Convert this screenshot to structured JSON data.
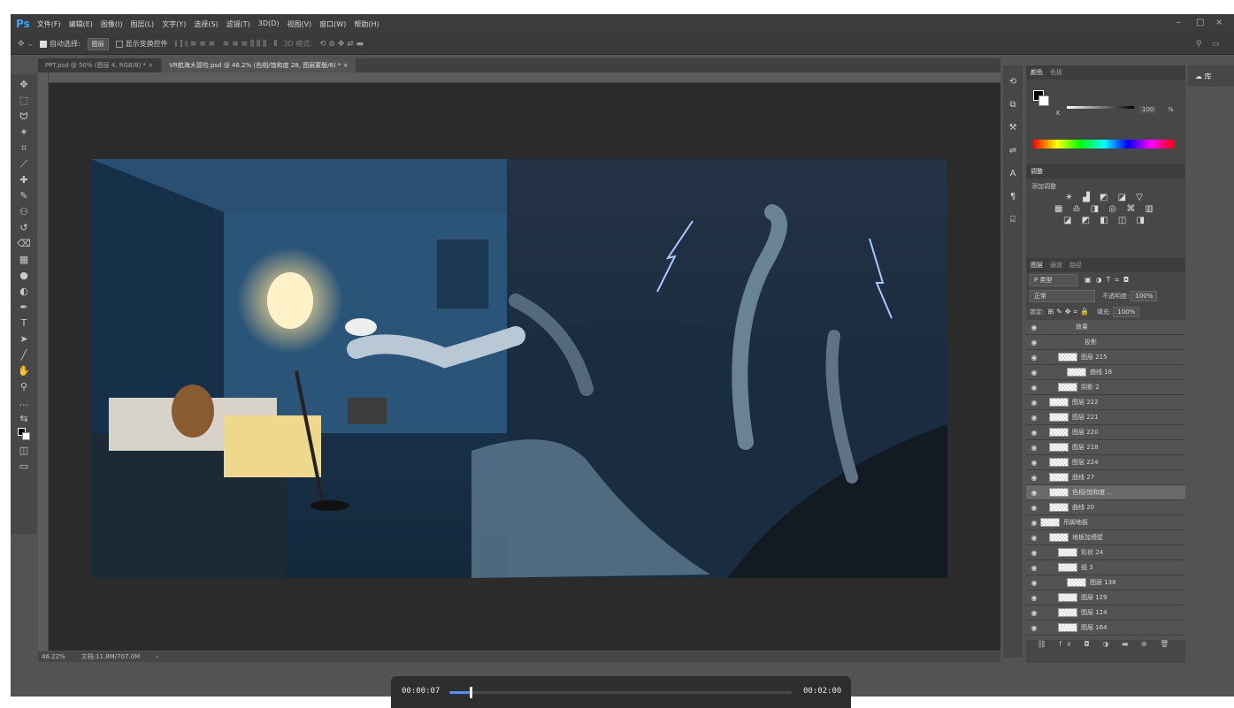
{
  "app": {
    "logo": "Ps",
    "menu": [
      "文件(F)",
      "编辑(E)",
      "图像(I)",
      "图层(L)",
      "文字(Y)",
      "选择(S)",
      "滤镜(T)",
      "3D(D)",
      "视图(V)",
      "窗口(W)",
      "帮助(H)"
    ],
    "window_controls": {
      "minimize": "–",
      "maximize": "□",
      "close": "×"
    }
  },
  "options_bar": {
    "auto_select_label": "自动选择:",
    "auto_select_value": "图层",
    "show_transform_label": "显示变换控件",
    "mode_label": "3D 模式:"
  },
  "tabs": [
    {
      "label": "PPT.psd @ 50% (图层 4, RGB/8) *  ×",
      "active": false
    },
    {
      "label": "VR航海大冒险.psd @ 46.2% (色相/饱和度 28, 图层蒙版/8) *  ×",
      "active": true
    }
  ],
  "tools": [
    "move-icon",
    "marquee-icon",
    "lasso-icon",
    "magic-wand-icon",
    "crop-icon",
    "eyedropper-icon",
    "healing-icon",
    "brush-icon",
    "stamp-icon",
    "history-brush-icon",
    "eraser-icon",
    "gradient-icon",
    "blur-icon",
    "dodge-icon",
    "pen-icon",
    "type-icon",
    "path-select-icon",
    "line-icon",
    "hand-icon",
    "zoom-icon",
    "more-icon",
    "swap-colors-icon",
    "color-swatches-icon",
    "quick-mask-icon",
    "screen-mode-icon"
  ],
  "tool_glyphs": [
    "✥",
    "⬚",
    "ᗢ",
    "✶",
    "⌗",
    "⟋",
    "✚",
    "✎",
    "⚇",
    "↺",
    "⌫",
    "▦",
    "●",
    "◐",
    "✒",
    "T",
    "➤",
    "╱",
    "✋",
    "⚲",
    "…",
    "⇆",
    "◩",
    "◫",
    "▭"
  ],
  "status": {
    "zoom": "46.22%",
    "doc": "文档:11.8M/707.0M"
  },
  "color_panel": {
    "tabs": [
      "颜色",
      "色板"
    ],
    "channel": "K",
    "value": "100",
    "unit": "%"
  },
  "adjust_panel": {
    "tab": "调整",
    "add_label": "添加调整"
  },
  "layers_panel": {
    "tabs": [
      "图层",
      "通道",
      "路径"
    ],
    "filter": "P 类型",
    "blend_mode": "正常",
    "opacity_label": "不透明度:",
    "opacity": "100%",
    "lock_label": "锁定:",
    "fill_label": "填充:",
    "fill": "100%",
    "layers": [
      {
        "name": "效果",
        "indent": 4
      },
      {
        "name": "投影",
        "indent": 5
      },
      {
        "name": "图层 215",
        "indent": 2
      },
      {
        "name": "曲线 18",
        "indent": 3
      },
      {
        "name": "阴影 2",
        "indent": 2
      },
      {
        "name": "图层 222",
        "indent": 1
      },
      {
        "name": "图层 221",
        "indent": 1
      },
      {
        "name": "图层 220",
        "indent": 1
      },
      {
        "name": "图层 218",
        "indent": 1
      },
      {
        "name": "图层 224",
        "indent": 1
      },
      {
        "name": "曲线 27",
        "indent": 1
      },
      {
        "name": "色相/饱和度 ...",
        "indent": 1,
        "selected": true
      },
      {
        "name": "曲线 20",
        "indent": 1
      },
      {
        "name": "吊脚地板",
        "indent": 0
      },
      {
        "name": "地板加墙壁",
        "indent": 1
      },
      {
        "name": "形状 24",
        "indent": 2
      },
      {
        "name": "组 3",
        "indent": 2
      },
      {
        "name": "图层 138",
        "indent": 3
      },
      {
        "name": "图层 129",
        "indent": 2
      },
      {
        "name": "图层 124",
        "indent": 2
      },
      {
        "name": "图层 164",
        "indent": 2
      }
    ]
  },
  "library_tab": "库",
  "player": {
    "current": "00:00:07",
    "total": "00:02:00",
    "progress": 0.058
  }
}
